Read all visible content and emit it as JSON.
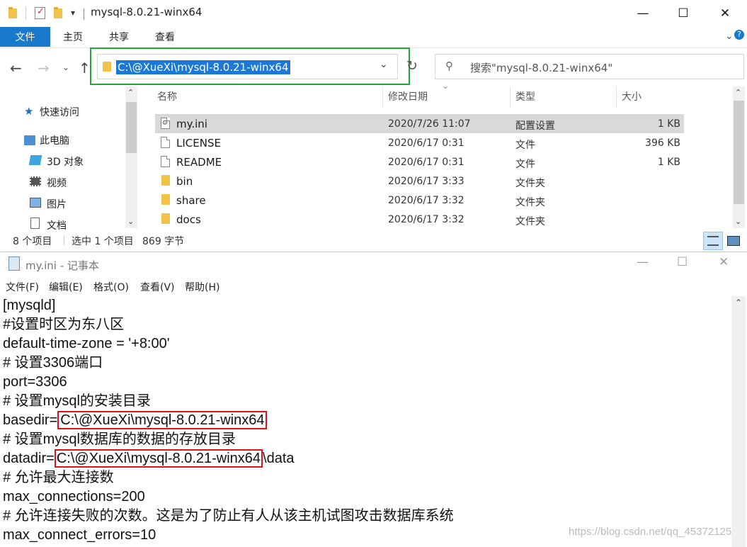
{
  "explorer": {
    "title": "mysql-8.0.21-winx64",
    "window_controls": {
      "minimize": "—",
      "maximize": "☐",
      "close": "✕"
    },
    "ribbon_tabs": [
      "文件",
      "主页",
      "共享",
      "查看"
    ],
    "address": "C:\\@XueXi\\mysql-8.0.21-winx64",
    "search_placeholder": "搜索\"mysql-8.0.21-winx64\"",
    "nav_pane": [
      {
        "label": "快速访问",
        "icon": "star-icon"
      },
      {
        "label": "此电脑",
        "icon": "computer-icon"
      },
      {
        "label": "3D 对象",
        "icon": "3d-objects-icon"
      },
      {
        "label": "视频",
        "icon": "video-icon"
      },
      {
        "label": "图片",
        "icon": "pictures-icon"
      },
      {
        "label": "文档",
        "icon": "documents-icon"
      }
    ],
    "columns": {
      "name": "名称",
      "modified": "修改日期",
      "type": "类型",
      "size": "大小"
    },
    "files": [
      {
        "name": "my.ini",
        "modified": "2020/7/26 11:07",
        "type": "配置设置",
        "size": "1 KB",
        "icon": "config-file-icon",
        "selected": true
      },
      {
        "name": "LICENSE",
        "modified": "2020/6/17 0:31",
        "type": "文件",
        "size": "396 KB",
        "icon": "file-icon",
        "selected": false
      },
      {
        "name": "README",
        "modified": "2020/6/17 0:31",
        "type": "文件",
        "size": "1 KB",
        "icon": "file-icon",
        "selected": false
      },
      {
        "name": "bin",
        "modified": "2020/6/17 3:33",
        "type": "文件夹",
        "size": "",
        "icon": "folder-icon",
        "selected": false
      },
      {
        "name": "share",
        "modified": "2020/6/17 3:32",
        "type": "文件夹",
        "size": "",
        "icon": "folder-icon",
        "selected": false
      },
      {
        "name": "docs",
        "modified": "2020/6/17 3:32",
        "type": "文件夹",
        "size": "",
        "icon": "folder-icon",
        "selected": false
      }
    ],
    "status": {
      "count": "8 个项目",
      "selection": "选中 1 个项目",
      "size": "869 字节"
    }
  },
  "notepad": {
    "title": "my.ini - 记事本",
    "window_controls": {
      "minimize": "—",
      "maximize": "☐",
      "close": "✕"
    },
    "menu": [
      "文件(F)",
      "编辑(E)",
      "格式(O)",
      "查看(V)",
      "帮助(H)"
    ],
    "lines": [
      "[mysqld]",
      "#设置时区为东八区",
      "default-time-zone = '+8:00'",
      "# 设置3306端口",
      "port=3306",
      "# 设置mysql的安装目录",
      "basedir=",
      "# 设置mysql数据库的数据的存放目录",
      "datadir=",
      "# 允许最大连接数",
      "max_connections=200",
      "# 允许连接失败的次数。这是为了防止有人从该主机试图攻击数据库系统",
      "max_connect_errors=10"
    ],
    "basedir_value": "C:\\@XueXi\\mysql-8.0.21-winx64",
    "datadir_value": "C:\\@XueXi\\mysql-8.0.21-winx64",
    "datadir_suffix": "\\data"
  },
  "watermark": "https://blog.csdn.net/qq_45372125",
  "colors": {
    "accent": "#1979ca",
    "highlight": "#22a83a",
    "annotation": "#d8141c",
    "selection": "#1b78d4"
  }
}
